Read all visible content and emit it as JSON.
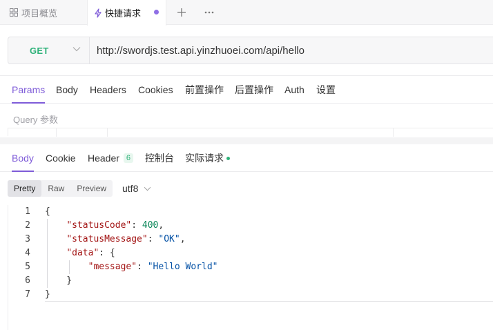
{
  "tabs": {
    "overview": "项目概览",
    "quick_request": "快捷请求",
    "add_icon": "plus-icon",
    "more_icon": "more-icon"
  },
  "request": {
    "method": "GET",
    "url": "http://swordjs.test.api.yinzhuoei.com/api/hello"
  },
  "request_tabs": [
    "Params",
    "Body",
    "Headers",
    "Cookies",
    "前置操作",
    "后置操作",
    "Auth",
    "设置"
  ],
  "request_active_tab": "Params",
  "query_label": "Query 参数",
  "response_tabs": {
    "body": "Body",
    "cookie": "Cookie",
    "header": "Header",
    "header_count": "6",
    "console": "控制台",
    "actual_request": "实际请求"
  },
  "view_modes": [
    "Pretty",
    "Raw",
    "Preview"
  ],
  "active_view_mode": "Pretty",
  "encoding": "utf8",
  "code": {
    "line_numbers": [
      "1",
      "2",
      "3",
      "4",
      "5",
      "6",
      "7"
    ],
    "status_code_key": "\"statusCode\"",
    "status_code_value": "400",
    "status_message_key": "\"statusMessage\"",
    "status_message_value": "\"OK\"",
    "data_key": "\"data\"",
    "message_key": "\"message\"",
    "message_value": "\"Hello World\""
  },
  "colors": {
    "accent": "#7e5bd8",
    "method_get": "#2fb27a",
    "json_key": "#a31515",
    "json_number": "#098658",
    "json_string": "#0451a5"
  }
}
